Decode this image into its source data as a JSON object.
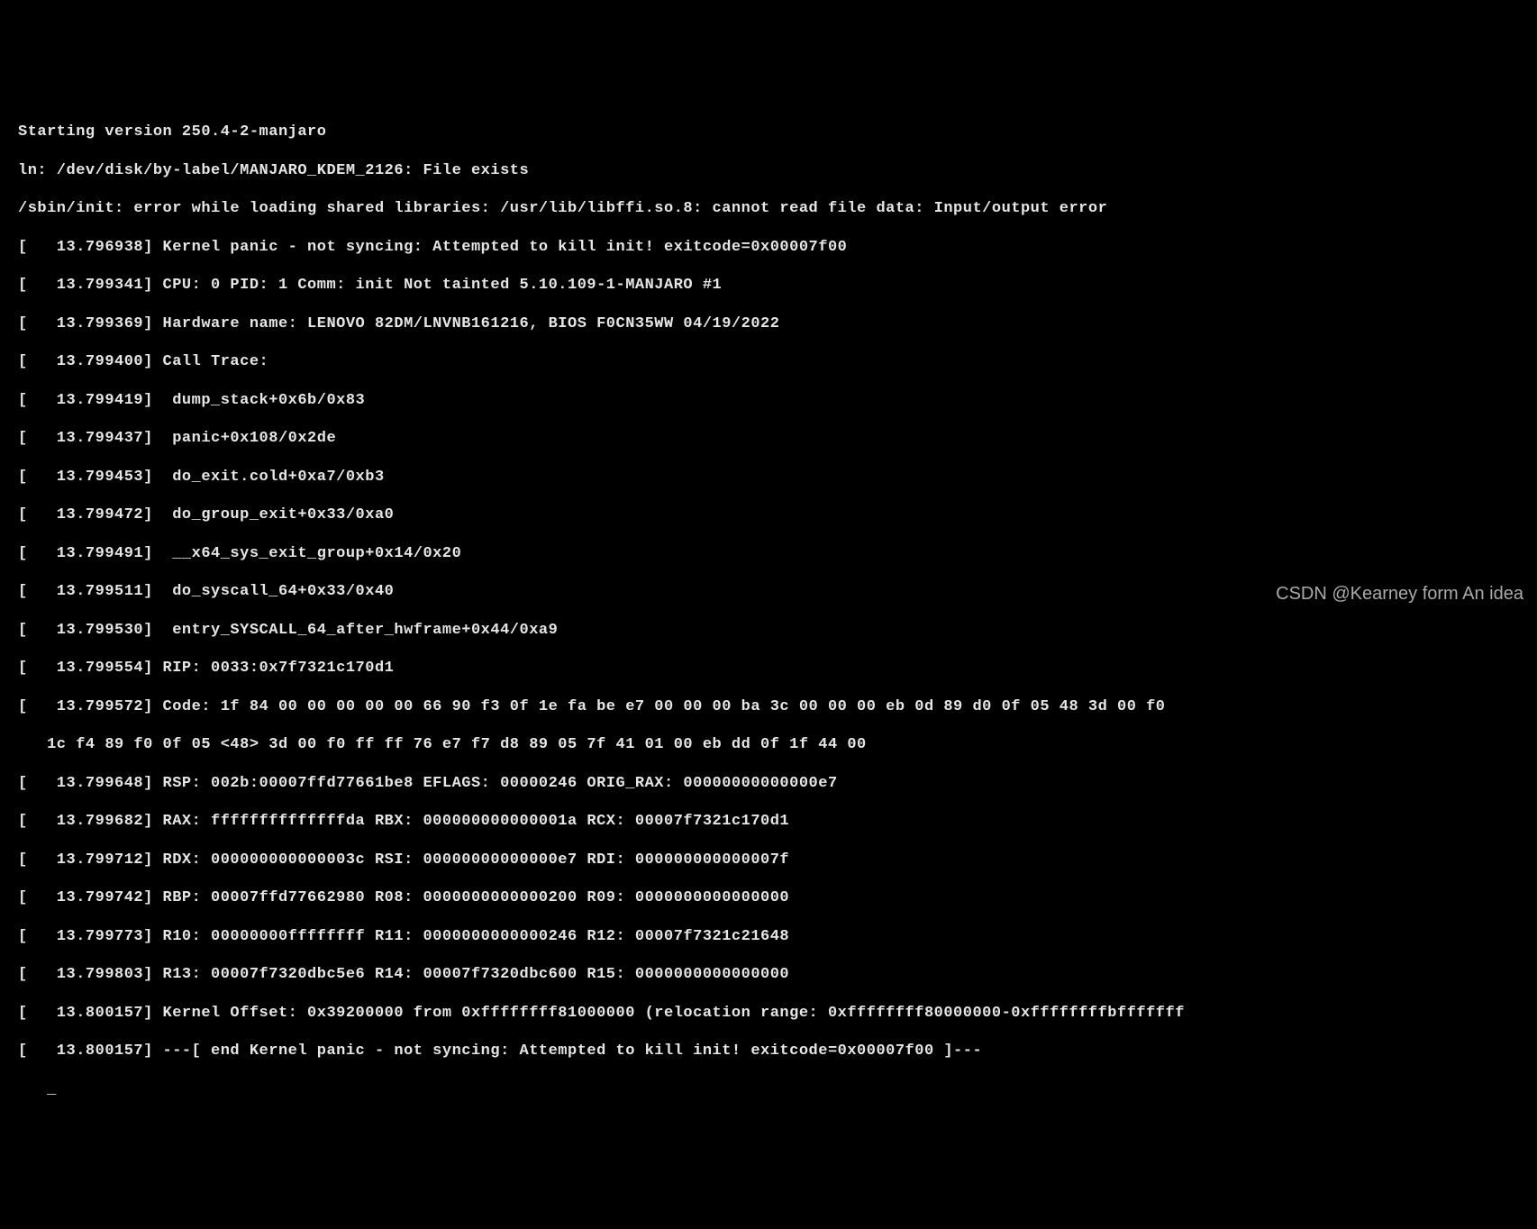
{
  "lines": [
    "Starting version 250.4-2-manjaro",
    "ln: /dev/disk/by-label/MANJARO_KDEM_2126: File exists",
    "/sbin/init: error while loading shared libraries: /usr/lib/libffi.so.8: cannot read file data: Input/output error",
    "[   13.796938] Kernel panic - not syncing: Attempted to kill init! exitcode=0x00007f00",
    "[   13.799341] CPU: 0 PID: 1 Comm: init Not tainted 5.10.109-1-MANJARO #1",
    "[   13.799369] Hardware name: LENOVO 82DM/LNVNB161216, BIOS F0CN35WW 04/19/2022",
    "[   13.799400] Call Trace:",
    "[   13.799419]  dump_stack+0x6b/0x83",
    "[   13.799437]  panic+0x108/0x2de",
    "[   13.799453]  do_exit.cold+0xa7/0xb3",
    "[   13.799472]  do_group_exit+0x33/0xa0",
    "[   13.799491]  __x64_sys_exit_group+0x14/0x20",
    "[   13.799511]  do_syscall_64+0x33/0x40",
    "[   13.799530]  entry_SYSCALL_64_after_hwframe+0x44/0xa9",
    "[   13.799554] RIP: 0033:0x7f7321c170d1",
    "[   13.799572] Code: 1f 84 00 00 00 00 00 66 90 f3 0f 1e fa be e7 00 00 00 ba 3c 00 00 00 eb 0d 89 d0 0f 05 48 3d 00 f0",
    "   1c f4 89 f0 0f 05 <48> 3d 00 f0 ff ff 76 e7 f7 d8 89 05 7f 41 01 00 eb dd 0f 1f 44 00",
    "[   13.799648] RSP: 002b:00007ffd77661be8 EFLAGS: 00000246 ORIG_RAX: 00000000000000e7",
    "[   13.799682] RAX: ffffffffffffffda RBX: 000000000000001a RCX: 00007f7321c170d1",
    "[   13.799712] RDX: 000000000000003c RSI: 00000000000000e7 RDI: 000000000000007f",
    "[   13.799742] RBP: 00007ffd77662980 R08: 0000000000000200 R09: 0000000000000000",
    "[   13.799773] R10: 00000000ffffffff R11: 0000000000000246 R12: 00007f7321c21648",
    "[   13.799803] R13: 00007f7320dbc5e6 R14: 00007f7320dbc600 R15: 0000000000000000",
    "[   13.800157] Kernel Offset: 0x39200000 from 0xffffffff81000000 (relocation range: 0xffffffff80000000-0xffffffffbfffffff",
    "[   13.800157] ---[ end Kernel panic - not syncing: Attempted to kill init! exitcode=0x00007f00 ]---",
    "   _"
  ],
  "watermark": "CSDN @Kearney form An idea"
}
